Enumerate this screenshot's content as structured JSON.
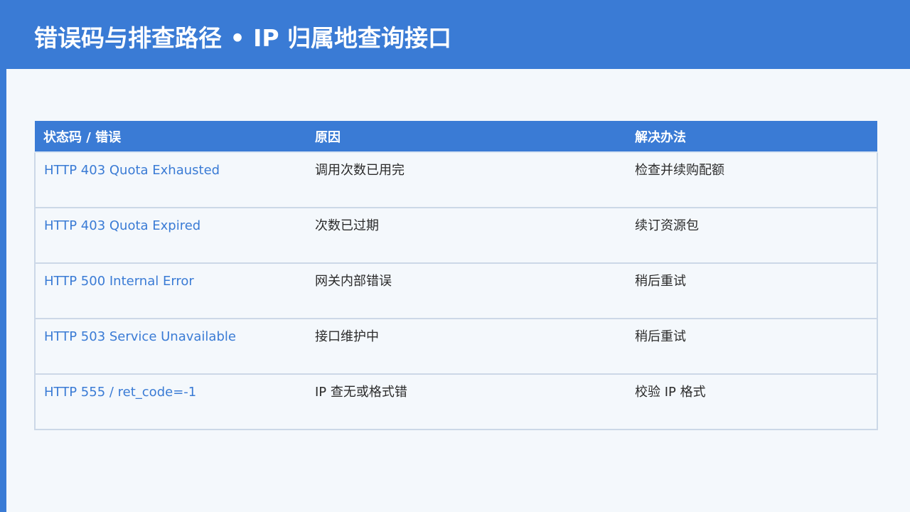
{
  "title": "错误码与排查路径 • IP 归属地查询接口",
  "colors": {
    "accent": "#3a7bd5",
    "background": "#f4f8fc",
    "code_text": "#3a7bd5",
    "body_text": "#2b2b2b"
  },
  "table": {
    "headers": [
      "状态码 / 错误",
      "原因",
      "解决办法"
    ],
    "rows": [
      {
        "code": "HTTP 403 Quota Exhausted",
        "reason": "调用次数已用完",
        "solution": "检查并续购配额"
      },
      {
        "code": "HTTP 403 Quota Expired",
        "reason": "次数已过期",
        "solution": "续订资源包"
      },
      {
        "code": "HTTP 500 Internal Error",
        "reason": "网关内部错误",
        "solution": "稍后重试"
      },
      {
        "code": "HTTP 503 Service Unavailable",
        "reason": "接口维护中",
        "solution": "稍后重试"
      },
      {
        "code": "HTTP 555 / ret_code=-1",
        "reason": "IP 查无或格式错",
        "solution": "校验 IP 格式"
      }
    ]
  }
}
